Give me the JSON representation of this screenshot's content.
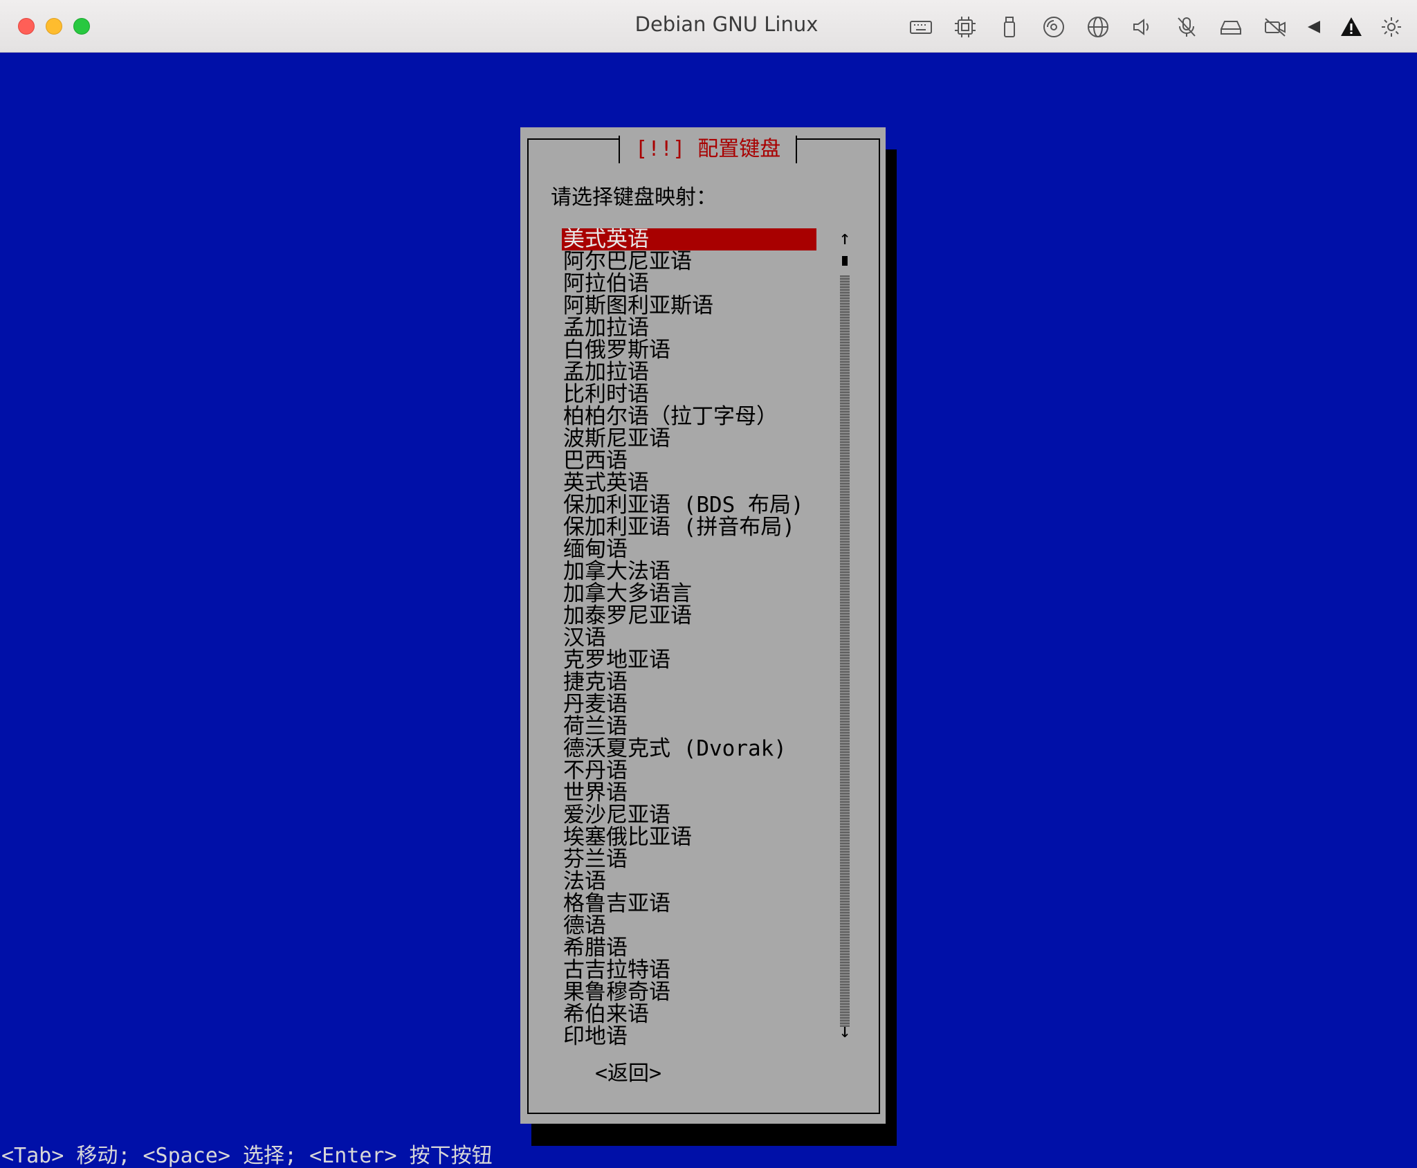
{
  "window": {
    "title": "Debian GNU Linux",
    "toolbar_icons": [
      "keyboard-icon",
      "cpu-icon",
      "usb-icon",
      "disc-icon",
      "network-icon",
      "speaker-icon",
      "microphone-muted-icon",
      "drive-icon",
      "camera-off-icon",
      "back-arrow-icon",
      "warning-icon",
      "settings-icon"
    ]
  },
  "dialog": {
    "title": "[!!] 配置键盘",
    "prompt": "请选择键盘映射：",
    "selected_index": 0,
    "items": [
      "美式英语",
      "阿尔巴尼亚语",
      "阿拉伯语",
      "阿斯图利亚斯语",
      "孟加拉语",
      "白俄罗斯语",
      "孟加拉语",
      "比利时语",
      "柏柏尔语（拉丁字母）",
      "波斯尼亚语",
      "巴西语",
      "英式英语",
      "保加利亚语 (BDS 布局)",
      "保加利亚语 (拼音布局)",
      "缅甸语",
      "加拿大法语",
      "加拿大多语言",
      "加泰罗尼亚语",
      "汉语",
      "克罗地亚语",
      "捷克语",
      "丹麦语",
      "荷兰语",
      "德沃夏克式 (Dvorak)",
      "不丹语",
      "世界语",
      "爱沙尼亚语",
      "埃塞俄比亚语",
      "芬兰语",
      "法语",
      "格鲁吉亚语",
      "德语",
      "希腊语",
      "古吉拉特语",
      "果鲁穆奇语",
      "希伯来语",
      "印地语"
    ],
    "scroll_up": "↑",
    "scroll_down": "↓",
    "back_button": "<返回>"
  },
  "statusline": "<Tab> 移动; <Space> 选择; <Enter> 按下按钮",
  "colors": {
    "background": "#0010a8",
    "dialog": "#a8a8a8",
    "accent": "#a80000"
  }
}
